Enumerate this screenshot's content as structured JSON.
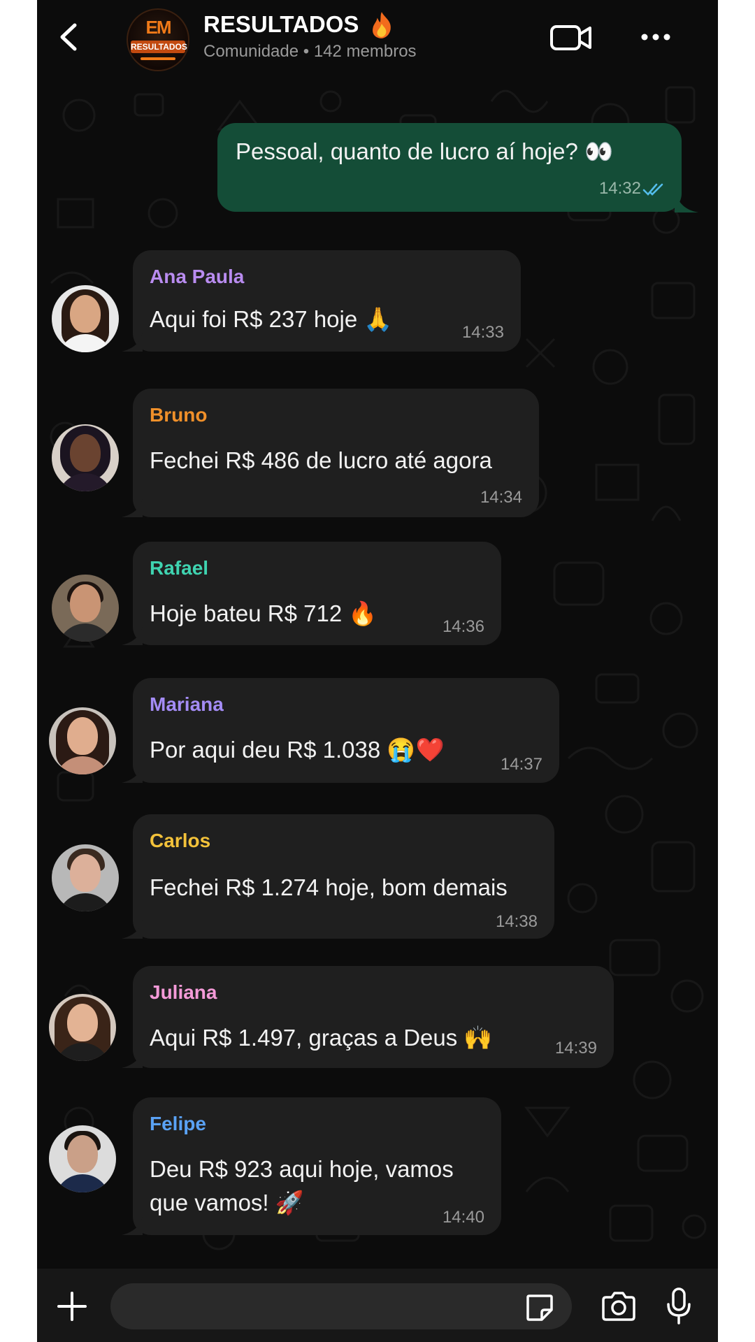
{
  "header": {
    "title": "RESULTADOS",
    "subtitle": "Comunidade • 142 membros",
    "avatar_text_top": "EM",
    "avatar_text_bottom": "RESULTADOS"
  },
  "outgoing": {
    "text": "Pessoal, quanto de lucro aí hoje? 👀",
    "time": "14:32"
  },
  "messages": [
    {
      "sender": "Ana Paula",
      "text": "Aqui foi R$ 237 hoje 🙏",
      "time": "14:33",
      "color": "#b98cf0"
    },
    {
      "sender": "Bruno",
      "text": "Fechei R$ 486 de lucro até agora",
      "time": "14:34",
      "color": "#f0902a"
    },
    {
      "sender": "Rafael",
      "text": "Hoje bateu R$ 712 🔥",
      "time": "14:36",
      "color": "#3fd3b0"
    },
    {
      "sender": "Mariana",
      "text": "Por aqui deu R$ 1.038 😭❤️",
      "time": "14:37",
      "color": "#a48cf5"
    },
    {
      "sender": "Carlos",
      "text": "Fechei R$ 1.274 hoje, bom demais",
      "time": "14:38",
      "color": "#f3c23a"
    },
    {
      "sender": "Juliana",
      "text": "Aqui R$ 1.497, graças a Deus 🙌",
      "time": "14:39",
      "color": "#f49ad8"
    },
    {
      "sender": "Felipe",
      "text_line1": "Deu R$ 923 aqui hoje, vamos",
      "text_line2": "que vamos! 🚀",
      "time": "14:40",
      "color": "#5aa2f5"
    }
  ],
  "input": {
    "placeholder": ""
  },
  "colors": {
    "background": "#0c0c0c",
    "incoming_bubble": "#1f1f1f",
    "outgoing_bubble": "#144d37",
    "read_ticks": "#53bdeb"
  },
  "icons": [
    "back-arrow-icon",
    "video-call-icon",
    "more-options-icon",
    "plus-icon",
    "sticker-icon",
    "camera-icon",
    "microphone-icon",
    "double-check-icon"
  ]
}
